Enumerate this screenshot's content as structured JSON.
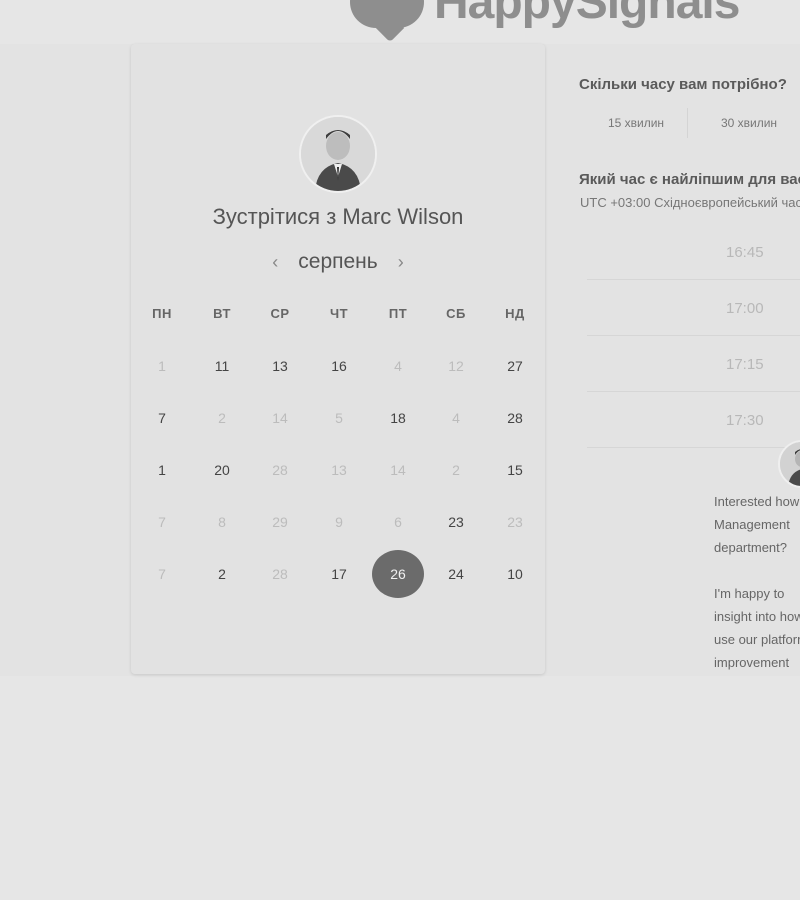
{
  "brand": {
    "logo_text": "HappySignals"
  },
  "calendar": {
    "title": "Зустрітися з Marc Wilson",
    "month": "серпень",
    "weekdays": [
      "ПН",
      "ВТ",
      "СР",
      "ЧТ",
      "ПТ",
      "СБ",
      "НД"
    ],
    "weeks": [
      [
        {
          "d": "1",
          "on": false
        },
        {
          "d": "11",
          "on": true
        },
        {
          "d": "13",
          "on": true
        },
        {
          "d": "16",
          "on": true
        },
        {
          "d": "4",
          "on": false
        },
        {
          "d": "12",
          "on": false
        },
        {
          "d": "27",
          "on": true
        }
      ],
      [
        {
          "d": "7",
          "on": true
        },
        {
          "d": "2",
          "on": false
        },
        {
          "d": "14",
          "on": false
        },
        {
          "d": "5",
          "on": false
        },
        {
          "d": "18",
          "on": true
        },
        {
          "d": "4",
          "on": false
        },
        {
          "d": "28",
          "on": true
        }
      ],
      [
        {
          "d": "1",
          "on": true
        },
        {
          "d": "20",
          "on": true
        },
        {
          "d": "28",
          "on": false
        },
        {
          "d": "13",
          "on": false
        },
        {
          "d": "14",
          "on": false
        },
        {
          "d": "2",
          "on": false
        },
        {
          "d": "15",
          "on": true
        }
      ],
      [
        {
          "d": "7",
          "on": false
        },
        {
          "d": "8",
          "on": false
        },
        {
          "d": "29",
          "on": false
        },
        {
          "d": "9",
          "on": false
        },
        {
          "d": "6",
          "on": false
        },
        {
          "d": "23",
          "on": true
        },
        {
          "d": "23",
          "on": false
        }
      ],
      [
        {
          "d": "7",
          "on": false
        },
        {
          "d": "2",
          "on": true
        },
        {
          "d": "28",
          "on": false
        },
        {
          "d": "17",
          "on": true
        },
        {
          "d": "26",
          "on": true,
          "selected": true
        },
        {
          "d": "24",
          "on": true
        },
        {
          "d": "10",
          "on": true
        }
      ]
    ]
  },
  "booking": {
    "duration_question": "Скільки часу вам потрібно?",
    "durations": [
      "15 хвилин",
      "30 хвилин"
    ],
    "time_question": "Який час є найліпшим для вас?",
    "timezone": "UTC +03:00 Східноєвропейський час",
    "slots": [
      "16:45",
      "17:00",
      "17:15",
      "17:30"
    ]
  },
  "message": {
    "text": "Interested how\nManagement\ndepartment?\n\nI'm happy to\ninsight into how\nuse our platform\nimprovement\nproductivity."
  },
  "icons": {
    "prev": "chevron-left-icon",
    "next": "chevron-right-icon"
  },
  "colors": {
    "selected_day": "#6b6b6b",
    "background": "#e6e6e6"
  }
}
